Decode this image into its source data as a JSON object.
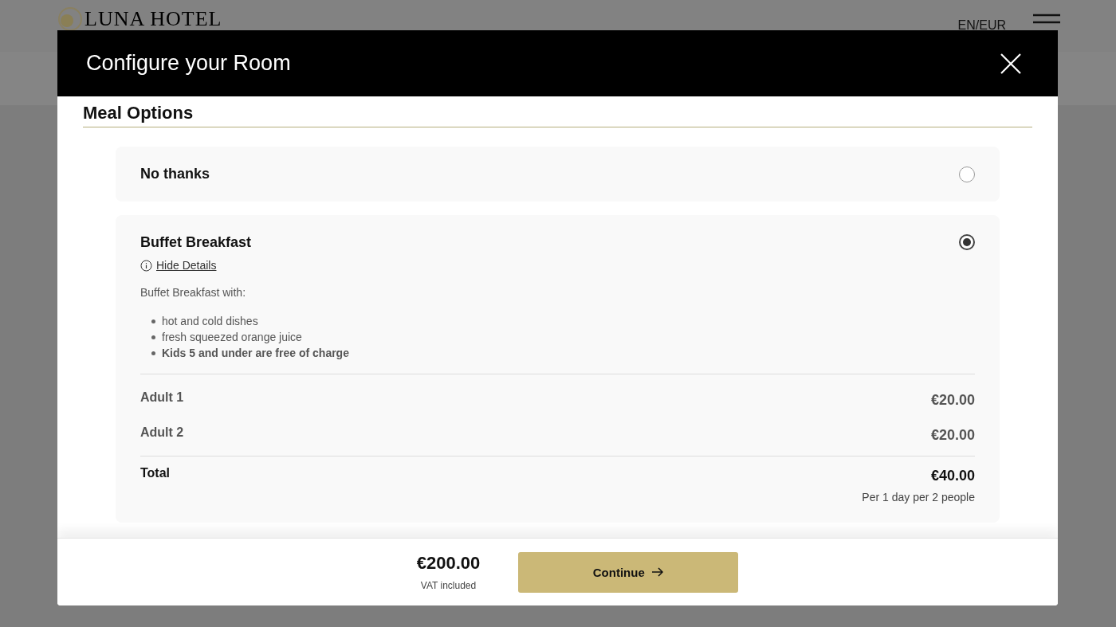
{
  "header": {
    "logo": "LUNA HOTEL",
    "locale": "EN/EUR"
  },
  "modal": {
    "title": "Configure your Room",
    "section_title": "Meal Options",
    "options": [
      {
        "name": "No thanks",
        "selected": false
      },
      {
        "name": "Buffet Breakfast",
        "selected": true,
        "details": {
          "toggle_label": "Hide Details",
          "intro": "Buffet Breakfast with:",
          "bullets": [
            {
              "text": "hot and cold dishes",
              "bold": false
            },
            {
              "text": "fresh squeezed orange juice",
              "bold": false
            },
            {
              "text": "Kids 5 and under are free of charge",
              "bold": true
            }
          ],
          "lines": [
            {
              "label": "Adult 1",
              "price": "€20.00"
            },
            {
              "label": "Adult 2",
              "price": "€20.00"
            }
          ],
          "total": {
            "label": "Total",
            "price": "€40.00",
            "note": "Per 1 day per 2 people"
          }
        }
      }
    ],
    "footer": {
      "price": "€200.00",
      "note": "VAT included",
      "button": "Continue"
    }
  }
}
